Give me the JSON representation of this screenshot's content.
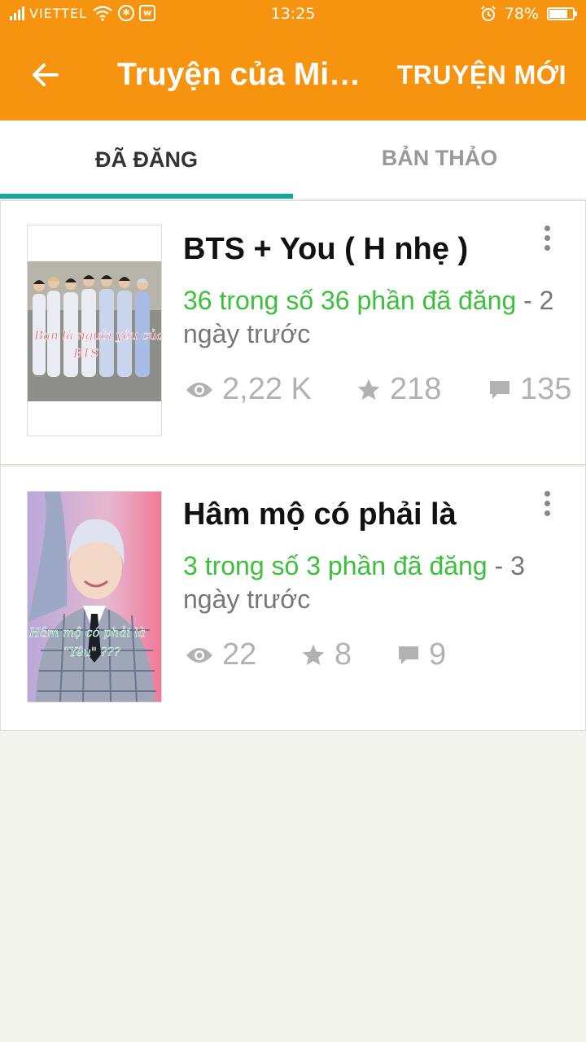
{
  "status_bar": {
    "carrier": "VIETTEL",
    "time": "13:25",
    "battery_percent": "78%",
    "battery_level": 0.78,
    "icons": [
      "signal-icon",
      "wifi-icon",
      "app-icon",
      "w-icon",
      "alarm-icon",
      "battery-icon"
    ]
  },
  "app_bar": {
    "back_icon": "arrow-left-icon",
    "title": "Truyện của Min...",
    "new_story_label": "TRUYỆN MỚI",
    "background_color": "#f6930f"
  },
  "tabs": [
    {
      "label": "ĐÃ ĐĂNG",
      "active": true
    },
    {
      "label": "BẢN THẢO",
      "active": false
    }
  ],
  "accent_color": "#17a69a",
  "stories": [
    {
      "title": "BTS + You ( H nhẹ )",
      "parts": "36 trong số 36 phần đã đăng",
      "when": " - 2 ngày trước",
      "views": "2,22 K",
      "votes": "218",
      "comments": "135",
      "cover_caption": "Bạn là người yêu của BTS"
    },
    {
      "title": "Hâm mộ có phải là",
      "parts": "3 trong số 3 phần đã đăng",
      "when": " - 3 ngày trước",
      "views": "22",
      "votes": "8",
      "comments": "9",
      "cover_caption": "Hâm mộ có phải là \"Yêu\" ???"
    }
  ]
}
